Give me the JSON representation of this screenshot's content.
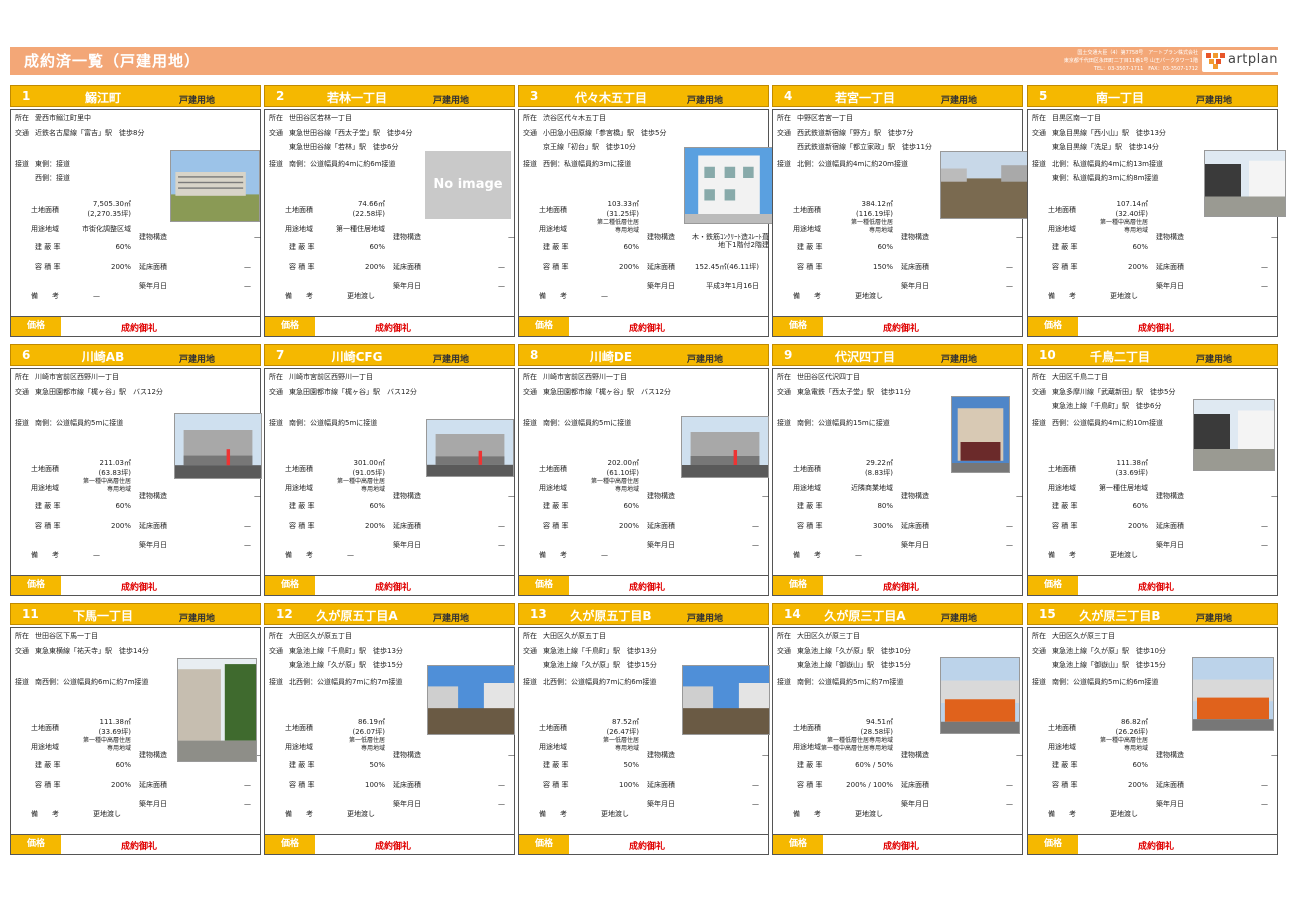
{
  "header": {
    "title": "成約済一覧（戸建用地）",
    "company_lines": [
      "国土交通大臣（4）第7758号　アートプラン株式会社",
      "東京都千代田区永田町二丁目11番1号 山王パークタワー1階",
      "TEL：03-3507-1711　FAX：03-3507-1712"
    ],
    "logo_text": "artplan"
  },
  "labels": {
    "address": "所在",
    "traffic": "交通",
    "road": "接道",
    "land_area": "土地面積",
    "zoning": "用途地域",
    "coverage": "建 蔽 率",
    "far": "容 積 率",
    "structure": "建物構造",
    "floor_area": "延床面積",
    "built": "築年月日",
    "remarks": "備　　考",
    "price": "価格",
    "price_value": "成約御礼",
    "no_image": "No image"
  },
  "colors": {
    "header": "#f3a777",
    "accent": "#f5b800",
    "price": "#e00000"
  },
  "cards": [
    {
      "num": "1",
      "name": "鰯江町",
      "type": "戸建用地",
      "addr": "愛西市鰯江町里中",
      "traffic": [
        "近鉄名古屋線「富吉」駅　徒歩8分"
      ],
      "road": [
        "東側：接道",
        "西側：接道"
      ],
      "area": "7,505.30㎡",
      "tsubo": "(2,270.35坪)",
      "zoning": [
        "市街化調整区域"
      ],
      "coverage": "60%",
      "far": "200%",
      "structure": "—",
      "floor": "—",
      "built": "—",
      "remarks": "—",
      "photo": "building"
    },
    {
      "num": "2",
      "name": "若林一丁目",
      "type": "戸建用地",
      "addr": "世田谷区若林一丁目",
      "traffic": [
        "東急世田谷線「西太子堂」駅　徒歩4分",
        "東急世田谷線「若林」駅　徒歩6分"
      ],
      "road": [
        "南側：公道幅員約4mに約6m接道"
      ],
      "area": "74.66㎡",
      "tsubo": "(22.58坪)",
      "zoning": [
        "第一種住居地域"
      ],
      "coverage": "60%",
      "far": "200%",
      "structure": "—",
      "floor": "—",
      "built": "—",
      "remarks": "更地渡し",
      "photo": "none"
    },
    {
      "num": "3",
      "name": "代々木五丁目",
      "type": "戸建用地",
      "addr": "渋谷区代々木五丁目",
      "traffic": [
        "小田急小田原線「参宮橋」駅　徒歩5分",
        "京王線「初台」駅　徒歩10分"
      ],
      "road": [
        "西側：私道幅員約3mに接道"
      ],
      "area": "103.33㎡",
      "tsubo": "(31.25坪)",
      "zoning": [
        "第二種低層住居",
        "専用地域"
      ],
      "coverage": "60%",
      "far": "200%",
      "structure": "木・鉄筋ｺﾝｸﾘｰﾄ造ｽﾚｰﾄ葺",
      "structure2": "地下1階付2階建",
      "floor": "152.45㎡(46.11坪)",
      "built": "平成3年1月16日",
      "remarks": "—",
      "photo": "house-white"
    },
    {
      "num": "4",
      "name": "若宮一丁目",
      "type": "戸建用地",
      "addr": "中野区若宮一丁目",
      "traffic": [
        "西武鉄道新宿線「野方」駅　徒歩7分",
        "西武鉄道新宿線「都立家政」駅　徒歩11分"
      ],
      "road": [
        "北側：公道幅員約4mに約20m接道"
      ],
      "area": "384.12㎡",
      "tsubo": "(116.19坪)",
      "zoning": [
        "第一種低層住居",
        "専用地域"
      ],
      "coverage": "60%",
      "far": "150%",
      "structure": "—",
      "floor": "—",
      "built": "—",
      "remarks": "更地渡し",
      "photo": "lot"
    },
    {
      "num": "5",
      "name": "南一丁目",
      "type": "戸建用地",
      "addr": "目黒区南一丁目",
      "traffic": [
        "東急目黒線「西小山」駅　徒歩13分",
        "東急目黒線「洗足」駅　徒歩14分"
      ],
      "road": [
        "北側：私道幅員約4mに約13m接道",
        "東側：私道幅員約3mに約8m接道"
      ],
      "area": "107.14㎡",
      "tsubo": "(32.40坪)",
      "zoning": [
        "第一種中高層住居",
        "専用地域"
      ],
      "coverage": "60%",
      "far": "200%",
      "structure": "—",
      "floor": "—",
      "built": "—",
      "remarks": "更地渡し",
      "photo": "street"
    },
    {
      "num": "6",
      "name": "川崎AB",
      "type": "戸建用地",
      "addr": "川崎市宮前区西野川一丁目",
      "traffic": [
        "東急田園都市線「梶ヶ谷」駅　バス12分"
      ],
      "road": [
        "南側：公道幅員約5mに接道"
      ],
      "area": "211.03㎡",
      "tsubo": "(63.83坪)",
      "zoning": [
        "第一種中高層住居",
        "専用地域"
      ],
      "coverage": "60%",
      "far": "200%",
      "structure": "—",
      "floor": "—",
      "built": "—",
      "remarks": "—",
      "photo": "wall"
    },
    {
      "num": "7",
      "name": "川崎CFG",
      "type": "戸建用地",
      "addr": "川崎市宮前区西野川一丁目",
      "traffic": [
        "東急田園都市線「梶ヶ谷」駅　バス12分"
      ],
      "road": [
        "南側：公道幅員約5mに接道"
      ],
      "area": "301.00㎡",
      "tsubo": "(91.05坪)",
      "zoning": [
        "第一種中高層住居",
        "専用地域"
      ],
      "coverage": "60%",
      "far": "200%",
      "structure": "—",
      "floor": "—",
      "built": "—",
      "remarks": "—",
      "photo": "wall"
    },
    {
      "num": "8",
      "name": "川崎DE",
      "type": "戸建用地",
      "addr": "川崎市宮前区西野川一丁目",
      "traffic": [
        "東急田園都市線「梶ヶ谷」駅　バス12分"
      ],
      "road": [
        "南側：公道幅員約5mに接道"
      ],
      "area": "202.00㎡",
      "tsubo": "(61.10坪)",
      "zoning": [
        "第一種中高層住居",
        "専用地域"
      ],
      "coverage": "60%",
      "far": "200%",
      "structure": "—",
      "floor": "—",
      "built": "—",
      "remarks": "—",
      "photo": "wall"
    },
    {
      "num": "9",
      "name": "代沢四丁目",
      "type": "戸建用地",
      "addr": "世田谷区代沢四丁目",
      "traffic": [
        "東急電鉄「西太子堂」駅　徒歩11分"
      ],
      "road": [
        "南側：公道幅員約15mに接道"
      ],
      "area": "29.22㎡",
      "tsubo": "(8.83坪)",
      "zoning": [
        "近隣商業地域"
      ],
      "coverage": "80%",
      "far": "300%",
      "structure": "—",
      "floor": "—",
      "built": "—",
      "remarks": "—",
      "photo": "shop"
    },
    {
      "num": "10",
      "name": "千鳥二丁目",
      "type": "戸建用地",
      "addr": "大田区千鳥二丁目",
      "traffic": [
        "東急多摩川線「武蔵新田」駅　徒歩5分",
        "東急池上線「千鳥町」駅　徒歩6分"
      ],
      "road": [
        "西側：公道幅員約4mに約10m接道"
      ],
      "area": "111.38㎡",
      "tsubo": "(33.69坪)",
      "zoning": [
        "第一種住居地域"
      ],
      "coverage": "60%",
      "far": "200%",
      "structure": "—",
      "floor": "—",
      "built": "—",
      "remarks": "更地渡し",
      "photo": "street"
    },
    {
      "num": "11",
      "name": "下馬一丁目",
      "type": "戸建用地",
      "addr": "世田谷区下馬一丁目",
      "traffic": [
        "東急東横線「祐天寺」駅　徒歩14分"
      ],
      "road": [
        "南西側：公道幅員約6mに約7m接道"
      ],
      "area": "111.38㎡",
      "tsubo": "(33.69坪)",
      "zoning": [
        "第一種中高層住居",
        "専用地域"
      ],
      "coverage": "60%",
      "far": "200%",
      "structure": "—",
      "floor": "—",
      "built": "—",
      "remarks": "更地渡し",
      "photo": "alley"
    },
    {
      "num": "12",
      "name": "久が原五丁目A",
      "type": "戸建用地",
      "addr": "大田区久が原五丁目",
      "traffic": [
        "東急池上線「千鳥町」駅　徒歩13分",
        "東急池上線「久が原」駅　徒歩15分"
      ],
      "road": [
        "北西側：公道幅員約7mに約7m接道"
      ],
      "area": "86.19㎡",
      "tsubo": "(26.07坪)",
      "zoning": [
        "第一低層住居",
        "専用地域"
      ],
      "coverage": "50%",
      "far": "100%",
      "structure": "—",
      "floor": "—",
      "built": "—",
      "remarks": "更地渡し",
      "photo": "sky-lot"
    },
    {
      "num": "13",
      "name": "久が原五丁目B",
      "type": "戸建用地",
      "addr": "大田区久が原五丁目",
      "traffic": [
        "東急池上線「千鳥町」駅　徒歩13分",
        "東急池上線「久が原」駅　徒歩15分"
      ],
      "road": [
        "北西側：公道幅員約7mに約6m接道"
      ],
      "area": "87.52㎡",
      "tsubo": "(26.47坪)",
      "zoning": [
        "第一低層住居",
        "専用地域"
      ],
      "coverage": "50%",
      "far": "100%",
      "structure": "—",
      "floor": "—",
      "built": "—",
      "remarks": "更地渡し",
      "photo": "sky-lot"
    },
    {
      "num": "14",
      "name": "久が原三丁目A",
      "type": "戸建用地",
      "addr": "大田区久が原三丁目",
      "traffic": [
        "東急池上線「久が原」駅　徒歩10分",
        "東急池上線「御嶽山」駅　徒歩15分"
      ],
      "road": [
        "南側：公道幅員約5mに約7m接道"
      ],
      "area": "94.51㎡",
      "tsubo": "(28.58坪)",
      "zoning": [
        "第一種低層住居専用地域",
        "第一種中高層住居専用地域"
      ],
      "coverage": "60% / 50%",
      "far": "200% / 100%",
      "structure": "—",
      "floor": "—",
      "built": "—",
      "remarks": "更地渡し",
      "photo": "fence"
    },
    {
      "num": "15",
      "name": "久が原三丁目B",
      "type": "戸建用地",
      "addr": "大田区久が原三丁目",
      "traffic": [
        "東急池上線「久が原」駅　徒歩10分",
        "東急池上線「御嶽山」駅　徒歩15分"
      ],
      "road": [
        "南側：公道幅員約5mに約6m接道"
      ],
      "area": "86.82㎡",
      "tsubo": "(26.26坪)",
      "zoning": [
        "第一種中高層住居",
        "専用地域"
      ],
      "coverage": "60%",
      "far": "200%",
      "structure": "—",
      "floor": "—",
      "built": "—",
      "remarks": "更地渡し",
      "photo": "fence"
    }
  ]
}
